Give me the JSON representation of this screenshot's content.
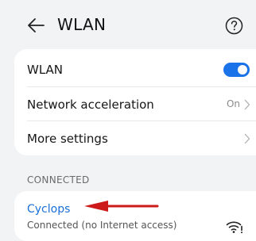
{
  "header": {
    "title": "WLAN",
    "back_icon": "arrow-left-icon",
    "help_icon": "question-circle-icon"
  },
  "settings": {
    "wlan_label": "WLAN",
    "wlan_enabled": true,
    "network_acceleration_label": "Network acceleration",
    "network_acceleration_value": "On",
    "more_settings_label": "More settings"
  },
  "connected": {
    "section_label": "CONNECTED",
    "network_name": "Cyclops",
    "network_status": "Connected (no Internet access)",
    "wifi_icon": "wifi-no-internet-icon"
  },
  "colors": {
    "accent": "#1a73e8",
    "annotation_arrow": "#cc1a1a",
    "background": "#f1f3f5"
  }
}
